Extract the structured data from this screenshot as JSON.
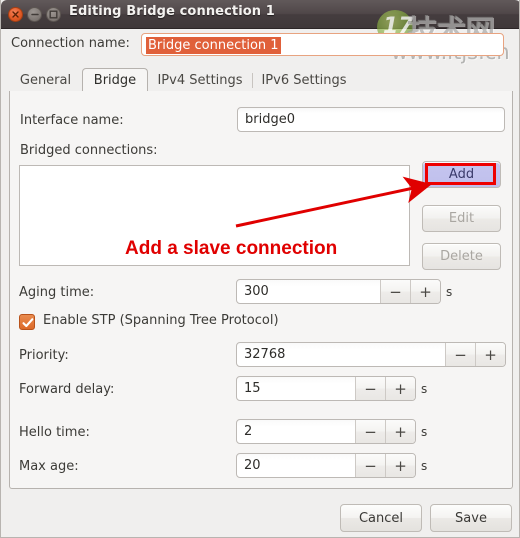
{
  "window": {
    "title": "Editing Bridge connection 1",
    "controls": {
      "close": "close-button",
      "minimize": "minimize-button",
      "maximize": "maximize-button"
    }
  },
  "watermark": {
    "badge": "17",
    "cjk": "技术网",
    "url": "www.itjs.cn"
  },
  "connection_name": {
    "label": "Connection name:",
    "value": "Bridge connection 1",
    "selected": true,
    "selection_color": "#e0603a"
  },
  "tabs": [
    {
      "label": "General",
      "active": false
    },
    {
      "label": "Bridge",
      "active": true
    },
    {
      "label": "IPv4 Settings",
      "active": false
    },
    {
      "label": "IPv6 Settings",
      "active": false
    }
  ],
  "form": {
    "interface_name": {
      "label": "Interface name:",
      "value": "bridge0"
    },
    "bridged_connections": {
      "label": "Bridged connections:",
      "items": []
    },
    "list_buttons": [
      {
        "label": "Add",
        "enabled": true,
        "highlighted": true
      },
      {
        "label": "Edit",
        "enabled": false,
        "highlighted": false
      },
      {
        "label": "Delete",
        "enabled": false,
        "highlighted": false
      }
    ],
    "aging_time": {
      "label": "Aging time:",
      "value": "300",
      "unit": "s"
    },
    "enable_stp": {
      "label": "Enable STP (Spanning Tree Protocol)",
      "checked": true
    },
    "priority": {
      "label": "Priority:",
      "value": "32768",
      "unit": ""
    },
    "forward_delay": {
      "label": "Forward delay:",
      "value": "15",
      "unit": "s"
    },
    "hello_time": {
      "label": "Hello time:",
      "value": "2",
      "unit": "s"
    },
    "max_age": {
      "label": "Max age:",
      "value": "20",
      "unit": "s"
    },
    "spinner_minus": "−",
    "spinner_plus": "+"
  },
  "annotation": {
    "text": "Add a slave connection",
    "color": "#e00000"
  },
  "footer": {
    "cancel": "Cancel",
    "save": "Save"
  }
}
